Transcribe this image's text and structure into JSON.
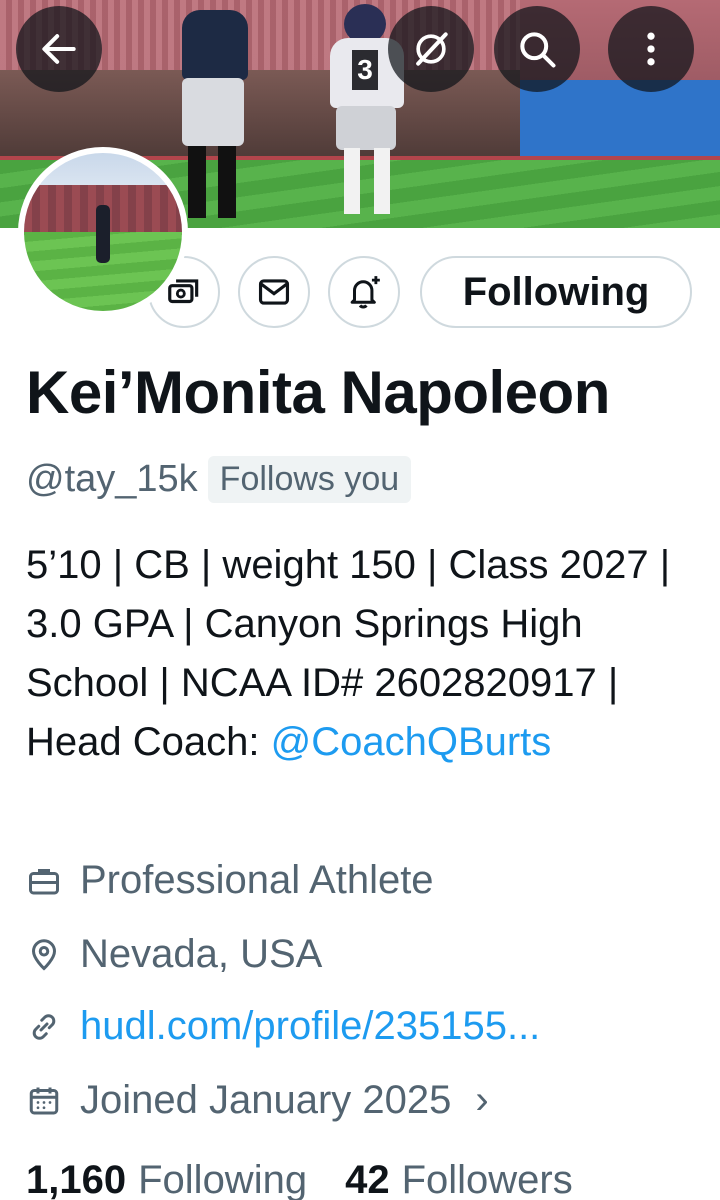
{
  "profile": {
    "name": "Kei’Monita Napoleon",
    "handle": "@tay_15k",
    "follows_you": "Follows you",
    "bio_text": "5’10 | CB | weight 150 | Class 2027 | 3.0 GPA | Canyon Springs High School | NCAA ID# 2602820917 | Head Coach: ",
    "bio_mention": "@CoachQBurts",
    "category": "Professional Athlete",
    "location": "Nevada, USA",
    "website": "hudl.com/profile/235155...",
    "joined": "Joined January 2025",
    "following_count": "1,160",
    "following_label": "Following",
    "followers_count": "42",
    "followers_label": "Followers"
  },
  "actions": {
    "following_button": "Following"
  },
  "banner": {
    "jersey_number": "3"
  },
  "icons": {
    "back": "arrow-left-icon",
    "grok": "grok-slash-icon",
    "search": "search-icon",
    "more": "more-vertical-icon",
    "tip": "money-icon",
    "message": "envelope-icon",
    "notify": "bell-plus-icon",
    "category": "briefcase-icon",
    "location": "location-pin-icon",
    "link": "link-icon",
    "joined": "calendar-icon"
  },
  "colors": {
    "accent": "#1d9bf0",
    "secondary_text": "#536471",
    "primary_text": "#0f1419"
  }
}
